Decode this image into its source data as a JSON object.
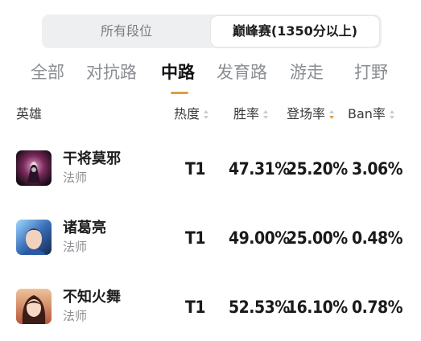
{
  "rank_filter": {
    "options": [
      {
        "label": "所有段位"
      },
      {
        "label": "巅峰赛(1350分以上)"
      }
    ],
    "selected": "巅峰赛(1350分以上)"
  },
  "lane_tabs": [
    {
      "label": "全部"
    },
    {
      "label": "对抗路"
    },
    {
      "label": "中路"
    },
    {
      "label": "发育路"
    },
    {
      "label": "游走"
    },
    {
      "label": "打野"
    }
  ],
  "active_tab": "中路",
  "table": {
    "headers": {
      "hero": "英雄",
      "heat": "热度",
      "win_rate": "胜率",
      "pick_rate": "登场率",
      "ban_rate": "Ban率"
    },
    "sorted_by": "登场率",
    "sort_direction": "descending",
    "rows": [
      {
        "name": "干将莫邪",
        "role": "法师",
        "heat": "T1",
        "win_rate": "47.31%",
        "pick_rate": "25.20%",
        "ban_rate": "3.06%"
      },
      {
        "name": "诸葛亮",
        "role": "法师",
        "heat": "T1",
        "win_rate": "49.00%",
        "pick_rate": "25.00%",
        "ban_rate": "0.48%"
      },
      {
        "name": "不知火舞",
        "role": "法师",
        "heat": "T1",
        "win_rate": "52.53%",
        "pick_rate": "16.10%",
        "ban_rate": "0.78%"
      }
    ]
  },
  "colors": {
    "accent": "#e0a03c",
    "segment_bg": "#eeeff1",
    "muted_text": "#8a8d92"
  }
}
